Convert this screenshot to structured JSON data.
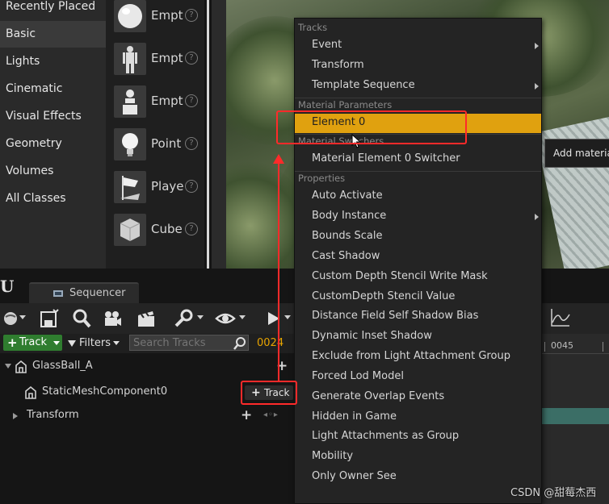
{
  "place_actors": {
    "categories": [
      "Recently Placed",
      "Basic",
      "Lights",
      "Cinematic",
      "Visual Effects",
      "Geometry",
      "Volumes",
      "All Classes"
    ],
    "active_category": "Basic",
    "actors": [
      {
        "label": "Empt",
        "icon": "sphere-icon"
      },
      {
        "label": "Empt",
        "icon": "mannequin-icon"
      },
      {
        "label": "Empt",
        "icon": "pawn-icon"
      },
      {
        "label": "Point",
        "icon": "lightbulb-icon"
      },
      {
        "label": "Playe",
        "icon": "flag-icon"
      },
      {
        "label": "Cube",
        "icon": "cube-icon"
      }
    ]
  },
  "sequencer": {
    "tab_label": "Sequencer",
    "track_button": "Track",
    "filters_label": "Filters",
    "search_placeholder": "Search Tracks",
    "current_frame": "0024",
    "timeline_frame": "0045",
    "tree": {
      "actor": "GlassBall_A",
      "component": "StaticMeshComponent0",
      "transform": "Transform",
      "component_track_button": "Track"
    }
  },
  "context_menu": {
    "sections": [
      {
        "header": "Tracks",
        "items": [
          {
            "label": "Event",
            "submenu": true
          },
          {
            "label": "Transform",
            "submenu": false
          },
          {
            "label": "Template Sequence",
            "submenu": true
          }
        ]
      },
      {
        "header": "Material Parameters",
        "items": [
          {
            "label": "Element 0",
            "submenu": false,
            "highlighted": true
          }
        ]
      },
      {
        "header": "Material Switchers",
        "items": [
          {
            "label": "Material Element 0 Switcher",
            "submenu": false
          }
        ]
      },
      {
        "header": "Properties",
        "items": [
          {
            "label": "Auto Activate",
            "submenu": false
          },
          {
            "label": "Body Instance",
            "submenu": true
          },
          {
            "label": "Bounds Scale",
            "submenu": false
          },
          {
            "label": "Cast Shadow",
            "submenu": false
          },
          {
            "label": "Custom Depth Stencil Write Mask",
            "submenu": false
          },
          {
            "label": "CustomDepth Stencil Value",
            "submenu": false
          },
          {
            "label": "Distance Field Self Shadow Bias",
            "submenu": false
          },
          {
            "label": "Dynamic Inset Shadow",
            "submenu": false
          },
          {
            "label": "Exclude from Light Attachment Group",
            "submenu": false
          },
          {
            "label": "Forced Lod Model",
            "submenu": false
          },
          {
            "label": "Generate Overlap Events",
            "submenu": false
          },
          {
            "label": "Hidden in Game",
            "submenu": false
          },
          {
            "label": "Light Attachments as Group",
            "submenu": false
          },
          {
            "label": "Mobility",
            "submenu": false
          },
          {
            "label": "Only Owner See",
            "submenu": false
          }
        ]
      }
    ]
  },
  "tooltip": "Add material",
  "watermark": "CSDN @甜莓杰西",
  "colors": {
    "highlight": "#e0a10f",
    "annotation": "#ff2a2a",
    "track_button": "#2f7d2f",
    "frame_number": "#e8a400"
  }
}
